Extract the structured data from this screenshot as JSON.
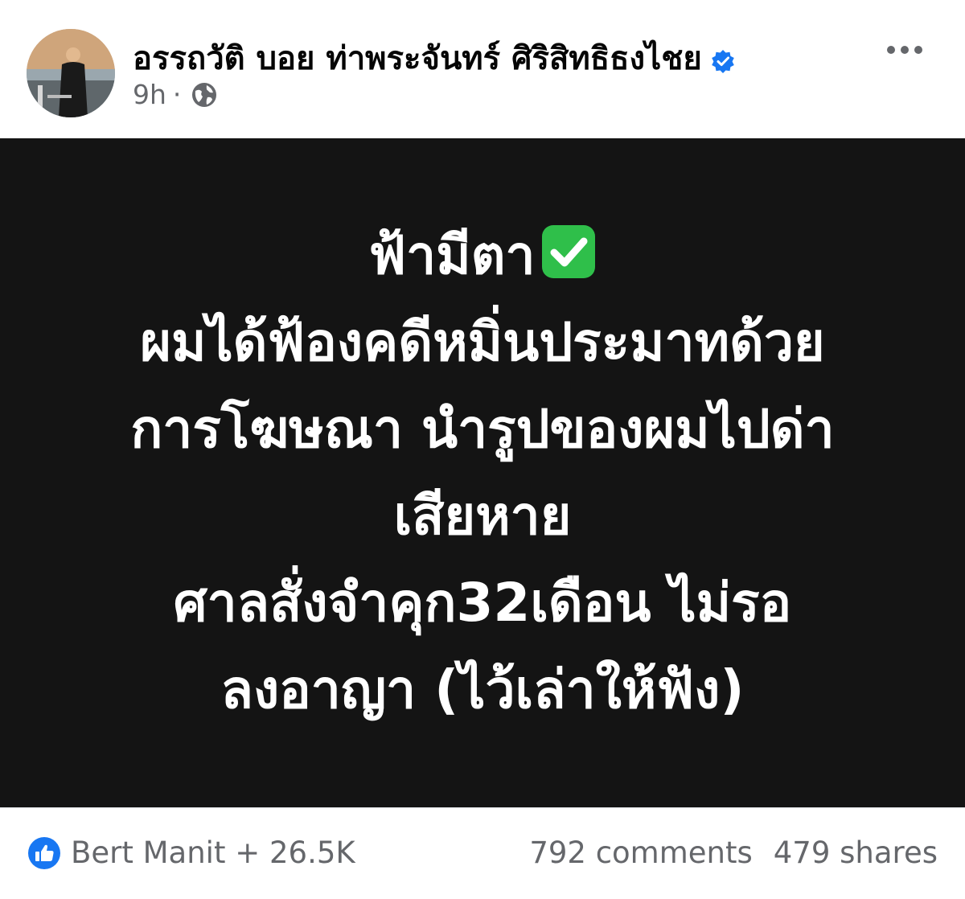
{
  "post": {
    "author": "อรรถวัติ บอย ท่าพระจันทร์ ศิริสิทธิธงไชย",
    "verified": true,
    "time": "9h",
    "separator": "·",
    "audience_icon": "globe-icon",
    "more_icon": "more-icon"
  },
  "image_text": {
    "line1": "ฟ้ามีตา",
    "line1_emoji": "check-mark-icon",
    "line2": "ผมได้ฟ้องคดีหมิ่นประมาทด้วย",
    "line3": "การโฆษณา นำรูปของผมไปด่า",
    "line4": "เสียหาย",
    "line5": "ศาลสั่งจำคุก32เดือน ไม่รอ",
    "line6": "ลงอาญา (ไว้เล่าให้ฟัง)"
  },
  "footer": {
    "reactions": "Bert Manit + 26.5K",
    "comments": "792 comments",
    "shares": "479 shares"
  },
  "colors": {
    "accent": "#1877f2",
    "check_green": "#2fbf4a",
    "image_bg": "#141414"
  }
}
